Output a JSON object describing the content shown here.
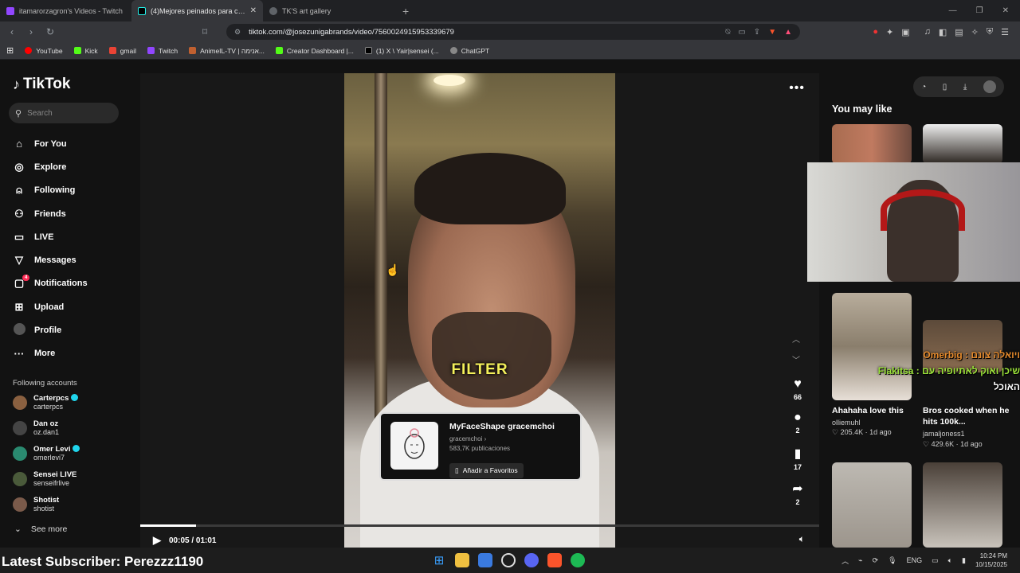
{
  "tabs": [
    {
      "title": "itamarorzagron's Videos - Twitch",
      "color": "#9146ff"
    },
    {
      "title": "(4)Mejores peinados para cualquier",
      "color": "#000000"
    },
    {
      "title": "TK'S art gallery",
      "color": "#5f6368"
    }
  ],
  "address": {
    "url": "tiktok.com/@josezunigabrands/video/7560024915953339679"
  },
  "bookmarks": [
    {
      "label": "YouTube",
      "color": "#ff0000"
    },
    {
      "label": "Kick",
      "color": "#53fc18"
    },
    {
      "label": "gmail",
      "color": "#ea4335"
    },
    {
      "label": "Twitch",
      "color": "#9146ff"
    },
    {
      "label": "AnimeIL-TV | אנימה...",
      "color": "#c06030"
    },
    {
      "label": "Creator Dashboard |...",
      "color": "#53fc18"
    },
    {
      "label": "(1) X \\ Yair|sensei (...",
      "color": "#000000"
    },
    {
      "label": "ChatGPT",
      "color": "#888888"
    }
  ],
  "sidebar": {
    "logo": "TikTok",
    "search_placeholder": "Search",
    "items": [
      {
        "label": "For You",
        "icon": "home-icon"
      },
      {
        "label": "Explore",
        "icon": "compass-icon"
      },
      {
        "label": "Following",
        "icon": "user-plus-icon"
      },
      {
        "label": "Friends",
        "icon": "friends-icon"
      },
      {
        "label": "LIVE",
        "icon": "live-icon"
      },
      {
        "label": "Messages",
        "icon": "send-icon"
      },
      {
        "label": "Notifications",
        "icon": "bell-icon",
        "badge": "4"
      },
      {
        "label": "Upload",
        "icon": "plus-square-icon"
      },
      {
        "label": "Profile",
        "icon": "avatar"
      },
      {
        "label": "More",
        "icon": "dots-icon"
      }
    ],
    "following_title": "Following accounts",
    "accounts": [
      {
        "name": "Carterpcs",
        "handle": "carterpcs",
        "verified": true
      },
      {
        "name": "Dan oz",
        "handle": "oz.dan1",
        "verified": false
      },
      {
        "name": "Omer Levi",
        "handle": "omerlevi7",
        "verified": true
      },
      {
        "name": "Sensei LIVE",
        "handle": "senseifrlive",
        "verified": false
      },
      {
        "name": "Shotist",
        "handle": "shotist",
        "verified": false
      }
    ],
    "see_more": "See more"
  },
  "video": {
    "caption_word": "FILTER",
    "effect": {
      "title": "MyFaceShape gracemchoi",
      "creator": "gracemchoi",
      "posts": "583,7K publicaciones",
      "fav_label": "Añadir a Favoritos"
    },
    "actions": {
      "likes": "66",
      "comments": "2",
      "saves": "17",
      "shares": "2"
    },
    "time": "00:05 / 01:01",
    "progress": 0.082
  },
  "right": {
    "you_may_like": "You may like",
    "cards": [
      {
        "caption": "Ahahaha love this",
        "author": "olliemuhl",
        "likes": "205.4K",
        "age": "1d ago"
      },
      {
        "caption": "Bros cooked when he hits 100k...",
        "author": "jamaljoness1",
        "likes": "429.6K",
        "age": "1d ago"
      }
    ]
  },
  "overlay": {
    "chat_lines": [
      "Omerbig : ויואלה צונם",
      "Flakitsa : שיכן ואוק לאתיופיה עם",
      "האוכל"
    ],
    "subscriber": "Latest Subscriber: Perezzz1190"
  },
  "taskbar": {
    "lang": "ENG",
    "time": "10:24 PM",
    "date": "10/15/2025"
  }
}
